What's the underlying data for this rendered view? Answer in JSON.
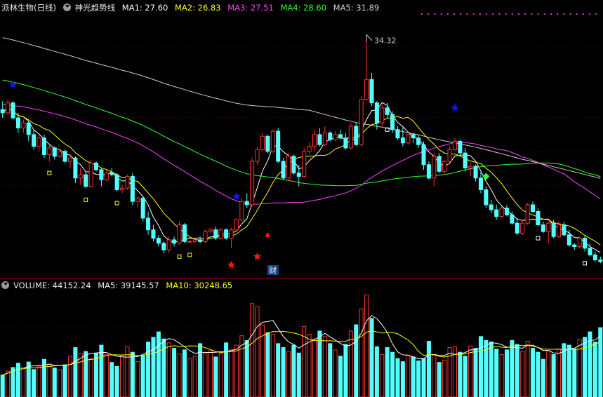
{
  "header": {
    "stock_name": "派林生物(日线)",
    "indicator_name": "神光趋势线",
    "ma1_label": "MA1: 27.60",
    "ma2_label": "MA2: 26.83",
    "ma3_label": "MA3: 27.51",
    "ma4_label": "MA4: 28.60",
    "ma5_label": "MA5: 31.89"
  },
  "volume_header": {
    "volume_label": "VOLUME: 44152.24",
    "ma5_label": "MA5: 39145.57",
    "ma10_label": "MA10: 30248.65"
  },
  "annotations": {
    "high_label": "34.32",
    "fin_marker": "财"
  },
  "colors": {
    "background": "#000000",
    "up": "#ff3030",
    "down": "#54ffff",
    "ma1": "#ffffff",
    "ma2": "#ffff00",
    "ma3": "#ff40ff",
    "ma4": "#30ff30",
    "ma5": "#cccccc",
    "star_blue": "#1515ff",
    "star_red": "#ff1515",
    "diamond_green": "#30ff30",
    "grid": "#8b0000"
  },
  "chart_data": {
    "type": "candlestick",
    "price_range": [
      20.2,
      35.9
    ],
    "x_count": 116,
    "candles": [
      [
        30.1,
        30.6,
        29.6,
        29.9
      ],
      [
        29.9,
        30.7,
        29.8,
        30.5
      ],
      [
        30.5,
        30.6,
        29.5,
        29.6
      ],
      [
        29.6,
        29.9,
        28.7,
        29.0
      ],
      [
        29.0,
        29.5,
        28.7,
        29.3
      ],
      [
        29.3,
        29.4,
        28.2,
        28.6
      ],
      [
        28.6,
        28.9,
        27.7,
        27.9
      ],
      [
        27.9,
        28.6,
        27.6,
        28.4
      ],
      [
        28.4,
        28.6,
        27.2,
        27.4
      ],
      [
        27.4,
        28.0,
        27.0,
        27.8
      ],
      [
        27.8,
        27.9,
        27.1,
        27.3
      ],
      [
        27.3,
        27.7,
        27.2,
        27.6
      ],
      [
        27.6,
        27.7,
        26.9,
        27.0
      ],
      [
        27.0,
        27.4,
        26.6,
        27.2
      ],
      [
        27.2,
        27.3,
        25.7,
        26.0
      ],
      [
        26.0,
        26.6,
        25.6,
        26.2
      ],
      [
        26.2,
        26.4,
        25.4,
        25.5
      ],
      [
        25.5,
        27.1,
        25.4,
        26.9
      ],
      [
        26.9,
        27.0,
        26.4,
        26.5
      ],
      [
        26.5,
        26.6,
        25.5,
        25.9
      ],
      [
        25.9,
        26.5,
        25.8,
        26.3
      ],
      [
        26.3,
        26.6,
        26.1,
        26.2
      ],
      [
        26.2,
        26.3,
        25.2,
        25.3
      ],
      [
        25.3,
        25.6,
        25.1,
        25.4
      ],
      [
        25.4,
        26.2,
        25.3,
        26.1
      ],
      [
        26.1,
        26.3,
        24.4,
        24.6
      ],
      [
        24.6,
        24.9,
        24.2,
        24.8
      ],
      [
        24.8,
        24.9,
        23.4,
        23.6
      ],
      [
        23.6,
        24.0,
        22.6,
        22.9
      ],
      [
        22.9,
        23.2,
        22.2,
        22.4
      ],
      [
        22.4,
        22.6,
        21.9,
        22.1
      ],
      [
        22.1,
        22.2,
        21.5,
        21.7
      ],
      [
        21.7,
        22.5,
        21.5,
        22.3
      ],
      [
        22.3,
        22.5,
        21.9,
        22.1
      ],
      [
        22.1,
        23.4,
        22.0,
        23.2
      ],
      [
        23.2,
        23.3,
        22.1,
        22.2
      ],
      [
        22.2,
        22.3,
        22.1,
        22.2
      ],
      [
        22.2,
        22.4,
        22.1,
        22.3
      ],
      [
        22.3,
        22.5,
        22.1,
        22.2
      ],
      [
        22.2,
        22.9,
        22.1,
        22.8
      ],
      [
        22.8,
        23.0,
        22.7,
        22.9
      ],
      [
        22.9,
        23.1,
        22.3,
        22.4
      ],
      [
        22.4,
        23.0,
        22.3,
        22.9
      ],
      [
        22.9,
        23.0,
        22.3,
        22.4
      ],
      [
        22.4,
        23.0,
        21.8,
        22.9
      ],
      [
        22.9,
        23.6,
        22.8,
        23.5
      ],
      [
        23.5,
        24.8,
        23.4,
        24.6
      ],
      [
        24.6,
        25.1,
        24.2,
        24.4
      ],
      [
        24.4,
        27.2,
        24.3,
        27.0
      ],
      [
        27.0,
        27.9,
        26.8,
        27.7
      ],
      [
        27.7,
        28.7,
        27.6,
        28.5
      ],
      [
        28.5,
        28.6,
        27.5,
        27.6
      ],
      [
        27.6,
        28.9,
        27.5,
        28.8
      ],
      [
        28.8,
        29.0,
        26.9,
        27.0
      ],
      [
        27.0,
        27.2,
        25.9,
        26.0
      ],
      [
        26.0,
        27.5,
        25.8,
        27.3
      ],
      [
        27.3,
        27.4,
        26.2,
        26.3
      ],
      [
        26.3,
        26.8,
        25.5,
        26.1
      ],
      [
        26.1,
        27.8,
        26.0,
        27.6
      ],
      [
        27.6,
        28.1,
        27.4,
        27.9
      ],
      [
        27.9,
        28.9,
        27.6,
        28.6
      ],
      [
        28.6,
        29.0,
        27.9,
        28.0
      ],
      [
        28.0,
        29.1,
        27.9,
        28.7
      ],
      [
        28.7,
        28.8,
        28.2,
        28.3
      ],
      [
        28.3,
        28.8,
        28.2,
        28.6
      ],
      [
        28.6,
        28.9,
        28.3,
        28.4
      ],
      [
        28.4,
        28.7,
        27.7,
        27.8
      ],
      [
        27.8,
        29.3,
        27.7,
        29.1
      ],
      [
        29.1,
        29.3,
        27.9,
        28.0
      ],
      [
        28.0,
        30.9,
        27.9,
        30.7
      ],
      [
        30.7,
        34.3,
        30.6,
        31.9
      ],
      [
        31.9,
        32.3,
        30.3,
        30.5
      ],
      [
        30.5,
        30.6,
        28.9,
        29.3
      ],
      [
        29.3,
        30.4,
        29.0,
        30.2
      ],
      [
        30.2,
        30.5,
        29.6,
        29.8
      ],
      [
        29.8,
        30.0,
        28.7,
        28.9
      ],
      [
        28.9,
        29.1,
        28.3,
        28.4
      ],
      [
        28.4,
        29.1,
        27.9,
        28.1
      ],
      [
        28.1,
        28.8,
        28.0,
        28.6
      ],
      [
        28.6,
        28.7,
        28.1,
        28.4
      ],
      [
        28.4,
        28.6,
        27.8,
        28.0
      ],
      [
        28.0,
        28.2,
        26.5,
        26.8
      ],
      [
        26.8,
        27.0,
        25.9,
        26.0
      ],
      [
        26.0,
        27.5,
        25.5,
        27.3
      ],
      [
        27.3,
        27.5,
        26.3,
        26.4
      ],
      [
        26.4,
        27.1,
        26.2,
        27.0
      ],
      [
        27.0,
        27.9,
        26.9,
        27.7
      ],
      [
        27.7,
        28.4,
        27.6,
        28.2
      ],
      [
        28.2,
        28.3,
        27.4,
        27.5
      ],
      [
        27.5,
        27.8,
        26.4,
        26.6
      ],
      [
        26.6,
        26.9,
        26.1,
        26.7
      ],
      [
        26.7,
        26.8,
        25.8,
        26.0
      ],
      [
        26.0,
        26.4,
        25.1,
        25.3
      ],
      [
        25.3,
        25.5,
        24.2,
        24.4
      ],
      [
        24.4,
        24.7,
        23.9,
        24.1
      ],
      [
        24.1,
        24.4,
        23.5,
        23.7
      ],
      [
        23.7,
        24.3,
        23.6,
        24.2
      ],
      [
        24.2,
        24.4,
        23.7,
        23.8
      ],
      [
        23.8,
        24.0,
        23.2,
        23.3
      ],
      [
        23.3,
        23.6,
        22.6,
        22.7
      ],
      [
        22.7,
        23.5,
        22.6,
        23.3
      ],
      [
        23.3,
        24.5,
        23.2,
        24.4
      ],
      [
        24.4,
        24.6,
        23.9,
        24.0
      ],
      [
        24.0,
        24.2,
        23.1,
        23.2
      ],
      [
        23.2,
        23.4,
        22.7,
        22.8
      ],
      [
        22.8,
        23.4,
        22.1,
        23.3
      ],
      [
        23.3,
        23.5,
        22.4,
        22.5
      ],
      [
        22.5,
        23.4,
        22.4,
        23.2
      ],
      [
        23.2,
        23.4,
        22.5,
        22.6
      ],
      [
        22.6,
        22.9,
        21.9,
        22.0
      ],
      [
        22.0,
        22.1,
        21.7,
        21.9
      ],
      [
        21.9,
        22.5,
        21.8,
        22.4
      ],
      [
        22.4,
        22.6,
        21.6,
        21.8
      ],
      [
        21.8,
        22.1,
        21.3,
        21.4
      ],
      [
        21.4,
        21.6,
        21.0,
        21.1
      ],
      [
        21.1,
        21.3,
        20.9,
        21.0
      ]
    ],
    "volumes": [
      14000,
      16500,
      18800,
      21500,
      19000,
      22300,
      17500,
      19600,
      24000,
      21000,
      18500,
      17300,
      20500,
      26000,
      31500,
      27500,
      29000,
      24300,
      28000,
      33000,
      27200,
      22000,
      19500,
      26200,
      32000,
      28500,
      22500,
      26500,
      35000,
      38000,
      41500,
      37000,
      34500,
      31000,
      27500,
      30000,
      24500,
      26000,
      34000,
      27500,
      29500,
      25500,
      28000,
      34500,
      30500,
      33000,
      39000,
      36000,
      59500,
      57500,
      46000,
      41000,
      40000,
      34000,
      31500,
      29000,
      33000,
      28000,
      45000,
      40000,
      37000,
      42000,
      38500,
      34000,
      30000,
      26000,
      33500,
      42000,
      46000,
      56000,
      65000,
      50000,
      32000,
      27000,
      31500,
      28500,
      24500,
      22500,
      26500,
      25500,
      23000,
      24500,
      35500,
      27000,
      22000,
      23500,
      31500,
      32000,
      28500,
      26000,
      32500,
      31000,
      38500,
      36000,
      35000,
      30500,
      27000,
      30000,
      36000,
      33500,
      29000,
      35500,
      31000,
      28500,
      24000,
      29500,
      27000,
      30500,
      34000,
      33000,
      30500,
      36500,
      38000,
      41500,
      35000,
      44152
    ],
    "ma_lines": {
      "MA1": 27.6,
      "MA2": 26.83,
      "MA3": 27.51,
      "MA4": 28.6,
      "MA5": 31.89
    },
    "high_marker": {
      "index": 70,
      "value": 34.32
    },
    "volume_range": [
      0,
      67000
    ]
  }
}
